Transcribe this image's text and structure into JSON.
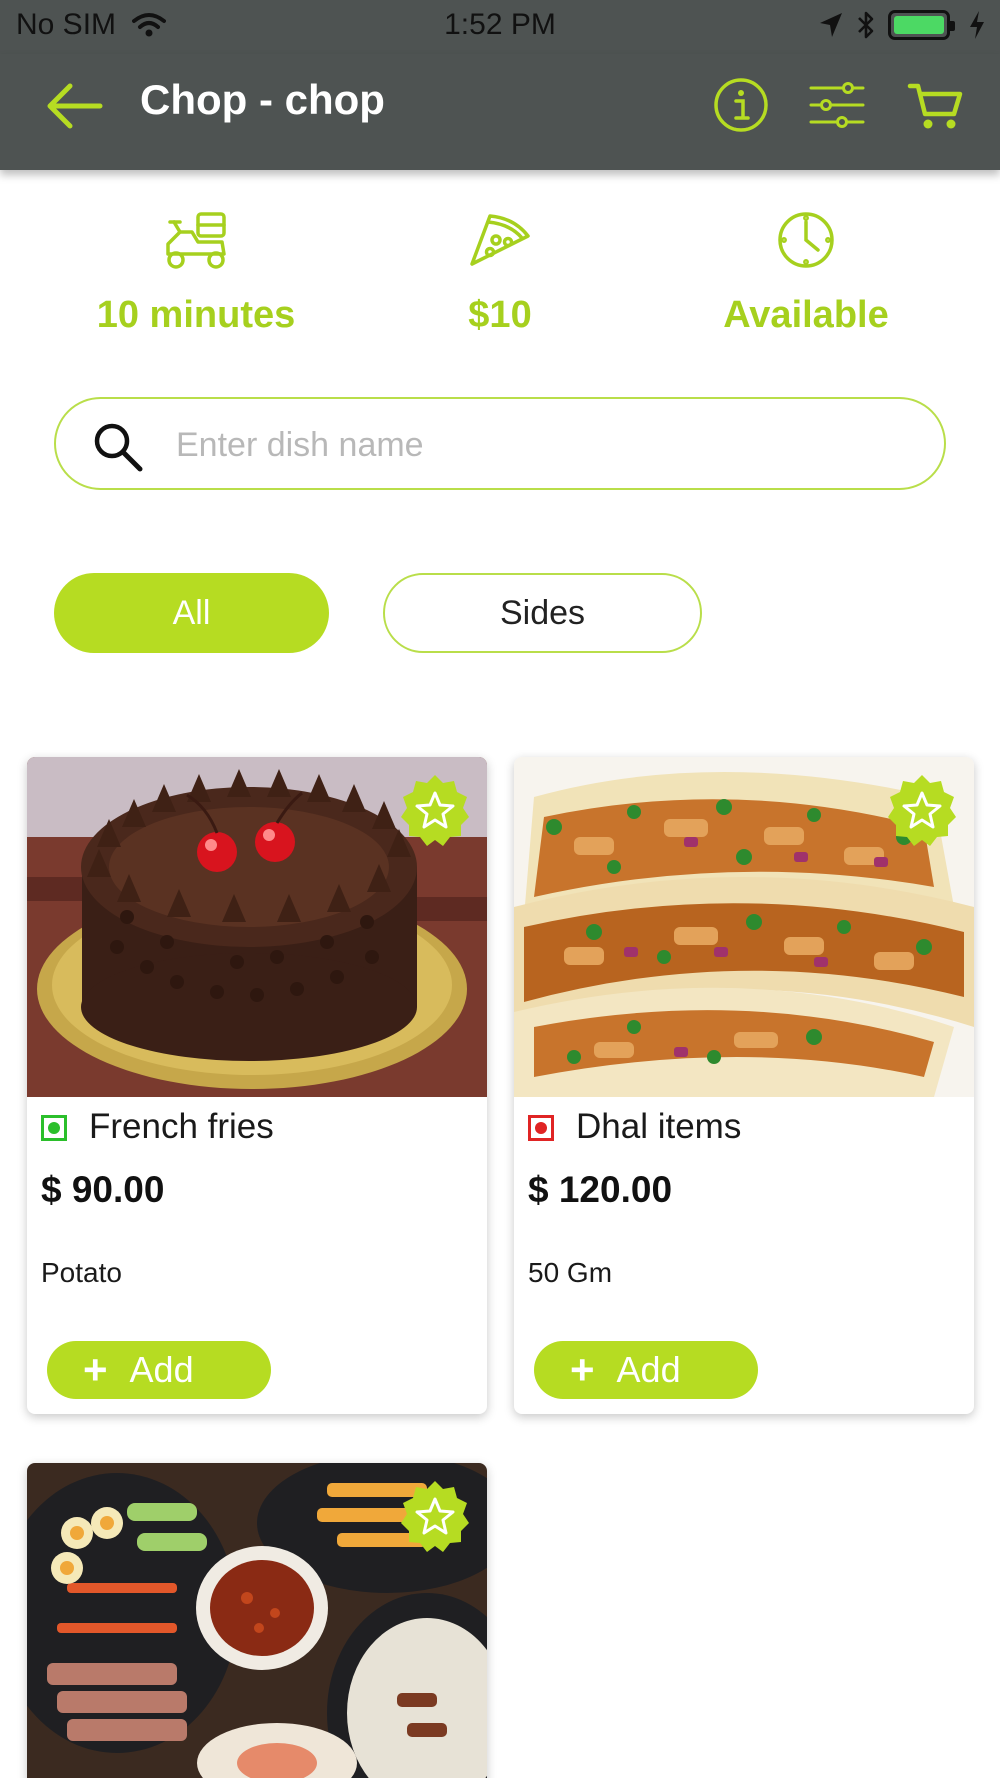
{
  "status_bar": {
    "carrier": "No SIM",
    "time": "1:52 PM"
  },
  "nav": {
    "title": "Chop - chop",
    "icons": [
      "back-arrow-icon",
      "info-icon",
      "filter-icon",
      "cart-icon"
    ]
  },
  "info": {
    "delivery_time": "10 minutes",
    "min_order": "$10",
    "availability": "Available"
  },
  "search": {
    "placeholder": "Enter dish name",
    "value": ""
  },
  "categories": [
    {
      "label": "All",
      "selected": true
    },
    {
      "label": "Sides",
      "selected": false
    }
  ],
  "dishes": [
    {
      "name": "French fries",
      "price": "$ 90.00",
      "description": "Potato",
      "add_label": "Add",
      "diet": "veg",
      "image": "chocolate-cake"
    },
    {
      "name": "Dhal items",
      "price": "$ 120.00",
      "description": "50 Gm",
      "add_label": "Add",
      "diet": "non-veg",
      "image": "tacos"
    },
    {
      "name": "",
      "price": "",
      "description": "",
      "add_label": "",
      "diet": "",
      "image": "thai-platter"
    }
  ],
  "colors": {
    "accent": "#b6dc22",
    "bar": "#4e5352",
    "veg": "#2bbf2b",
    "non_veg": "#e02424"
  }
}
